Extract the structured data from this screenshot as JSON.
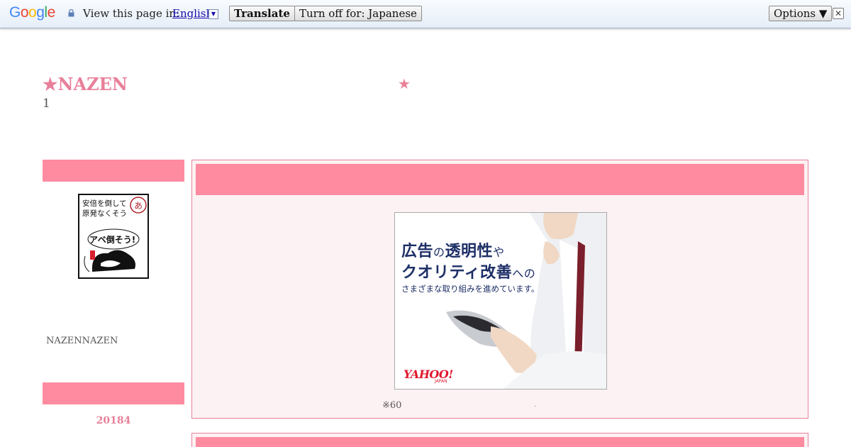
{
  "translate_bar": {
    "logo": [
      "G",
      "o",
      "o",
      "g",
      "l",
      "e"
    ],
    "logo_colors": [
      "#4285f4",
      "#ea4335",
      "#fbbc05",
      "#4285f4",
      "#34a853",
      "#ea4335"
    ],
    "label": "View this page in:",
    "language": "English",
    "dropdown_arrow": "▼",
    "translate_button": "Translate",
    "turn_off_button": "Turn off for: Japanese",
    "options_button": "Options ▼",
    "close": "✕"
  },
  "blog": {
    "title": "★NAZEN",
    "title_star": "★",
    "description": "1"
  },
  "sidebar": {
    "profile_image_text": [
      "安倍を倒して",
      "原発なくそう",
      "あ",
      "アベ倒そう!"
    ],
    "profile_name": "NAZENNAZEN",
    "archive_label": "20184"
  },
  "post": {
    "ad": {
      "line1_a": "広告",
      "line1_b": "の",
      "line1_c": "透明性",
      "line1_d": "や",
      "line2_a": "クオリティ改善",
      "line2_b": "への",
      "line3": "さまざまな取り組みを進めています。",
      "logo": "YAHOO!",
      "logo_sub": "JAPAN"
    },
    "note": "※60",
    "dot": "."
  },
  "colors": {
    "accent": "#ff8ba0",
    "title_pink": "#e8809a",
    "post_bg": "#fdf2f3",
    "ad_navy": "#1d2f66"
  }
}
